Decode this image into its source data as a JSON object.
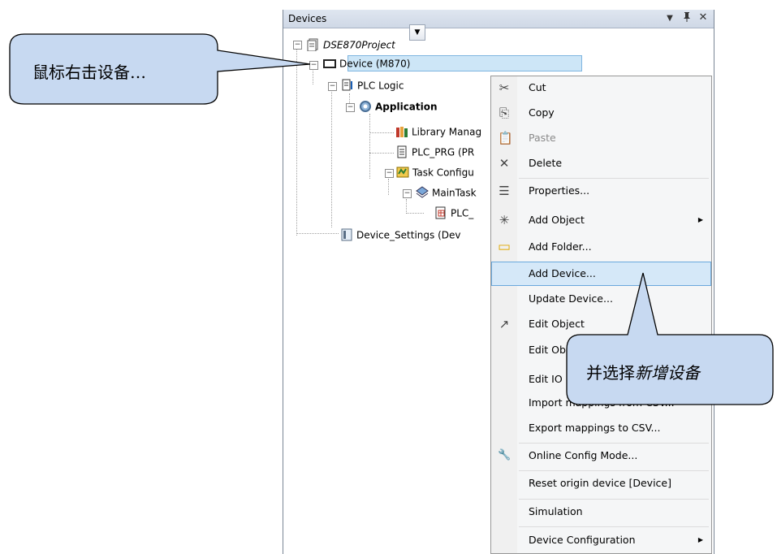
{
  "panel": {
    "title": "Devices",
    "dropdown_icon": "▼",
    "pin_icon": "ꟼ",
    "close_icon": "✕"
  },
  "tree": {
    "project": "DSE870Project",
    "device": "Device (M870)",
    "plc_logic": "PLC Logic",
    "application": "Application",
    "library_manager": "Library Manag",
    "plc_prg": "PLC_PRG (PR",
    "task_config": "Task Configu",
    "main_task": "MainTask",
    "plc_call": "PLC_",
    "device_settings": "Device_Settings (Dev"
  },
  "menu": {
    "items": [
      {
        "label": "Cut",
        "icon": "scissors-icon"
      },
      {
        "label": "Copy",
        "icon": "copy-icon"
      },
      {
        "label": "Paste",
        "icon": "paste-icon",
        "disabled": true
      },
      {
        "label": "Delete",
        "icon": "delete-icon"
      },
      {
        "label": "Properties...",
        "icon": "properties-icon"
      },
      {
        "label": "Add Object",
        "icon": "add-object-icon",
        "submenu": true
      },
      {
        "label": "Add Folder...",
        "icon": "folder-icon"
      },
      {
        "label": "Add Device...",
        "icon": "",
        "highlighted": true
      },
      {
        "label": "Update Device...",
        "icon": ""
      },
      {
        "label": "Edit Object",
        "icon": "edit-object-icon"
      },
      {
        "label": "Edit Ob",
        "icon": ""
      },
      {
        "label": "Edit IO",
        "icon": ""
      },
      {
        "label": "Import mappings from CSV...",
        "icon": ""
      },
      {
        "label": "Export mappings to CSV...",
        "icon": ""
      },
      {
        "label": "Online Config Mode...",
        "icon": "wrench-icon"
      },
      {
        "label": "Reset origin device [Device]",
        "icon": ""
      },
      {
        "label": "Simulation",
        "icon": ""
      },
      {
        "label": "Device Configuration",
        "icon": "",
        "submenu": true
      }
    ]
  },
  "callouts": {
    "left_text": "鼠标右击设备…",
    "right_text_a": "并选择",
    "right_text_b": "新增设备"
  },
  "colors": {
    "callout_fill": "#c7d9f1",
    "selection": "#cde6f7",
    "menu_hover": "#d5e8f8"
  }
}
